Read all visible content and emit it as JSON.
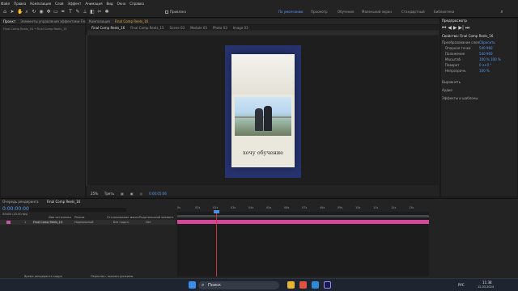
{
  "menu": [
    "Файл",
    "Правка",
    "Композиция",
    "Слой",
    "Эффект",
    "Анимация",
    "Вид",
    "Окно",
    "Справка"
  ],
  "workspaces": [
    "По умолчанию",
    "Просмотр",
    "Обучение",
    "Маленький экран",
    "Стандартный",
    "Библиотеки"
  ],
  "toolbar": {
    "snap_label": "Привязка"
  },
  "project": {
    "tabs": [
      "Проект",
      "Элементы управления эффектами Final C"
    ],
    "subtitle": "Final Comp Reels_16 • Final Comp Reels_15"
  },
  "comp": {
    "panel_label": "Композиция",
    "panel_name": "Final Comp Reels_16",
    "tabs": [
      "Final Comp Reels_16",
      "Final Comp Reels_15",
      "Scene 03",
      "Module 03",
      "Photo 03",
      "Image 03"
    ],
    "caption": "хочу обучение"
  },
  "viewer": {
    "zoom": "25%",
    "quality": "Треть",
    "time": "0:00:05:06"
  },
  "preview": {
    "title": "Предпросмотр",
    "props_title": "Свойства: Final Comp Reels_16",
    "transform": "Преобразование слоя",
    "reset": "Сбросить",
    "rows": [
      {
        "label": "Опорная точка",
        "value": "540   960"
      },
      {
        "label": "Положение",
        "value": "540   960"
      },
      {
        "label": "Масштаб",
        "value": "100 %   100 %"
      },
      {
        "label": "Поворот",
        "value": "0 x+0 °"
      },
      {
        "label": "Непрозрачн.",
        "value": "100 %"
      }
    ],
    "sections": [
      "Выровнять",
      "Аудио",
      "Эффекты и шаблоны"
    ]
  },
  "timeline": {
    "render_queue": "Очередь рендеринга",
    "comp_tab": "Final Comp Reels_16",
    "timecode": "0:00:00:00",
    "fps_note": "00000 (25.00 fps)",
    "search_placeholder": "",
    "columns": {
      "name": "Имя источника",
      "mode": "Режим",
      "track": "Отслеживание маски",
      "parent": "Родительский элемент"
    },
    "layer": {
      "index": "1",
      "name": "Final Comp Reels_15",
      "mode": "Нормальный",
      "track": "Без подкл.",
      "parent": "Нет"
    },
    "ruler": [
      "0s",
      "01s",
      "02s",
      "03s",
      "04s",
      "05s",
      "06s",
      "07s",
      "08s",
      "09s",
      "10s",
      "11s",
      "12s",
      "13s"
    ],
    "footer_left": "Время рендеринга кадра",
    "footer_mid": "Переключ. выключ./режимы"
  },
  "taskbar": {
    "search": "Поиск",
    "lang": "РУС",
    "time": "11:38",
    "date": "12.03.2024"
  }
}
